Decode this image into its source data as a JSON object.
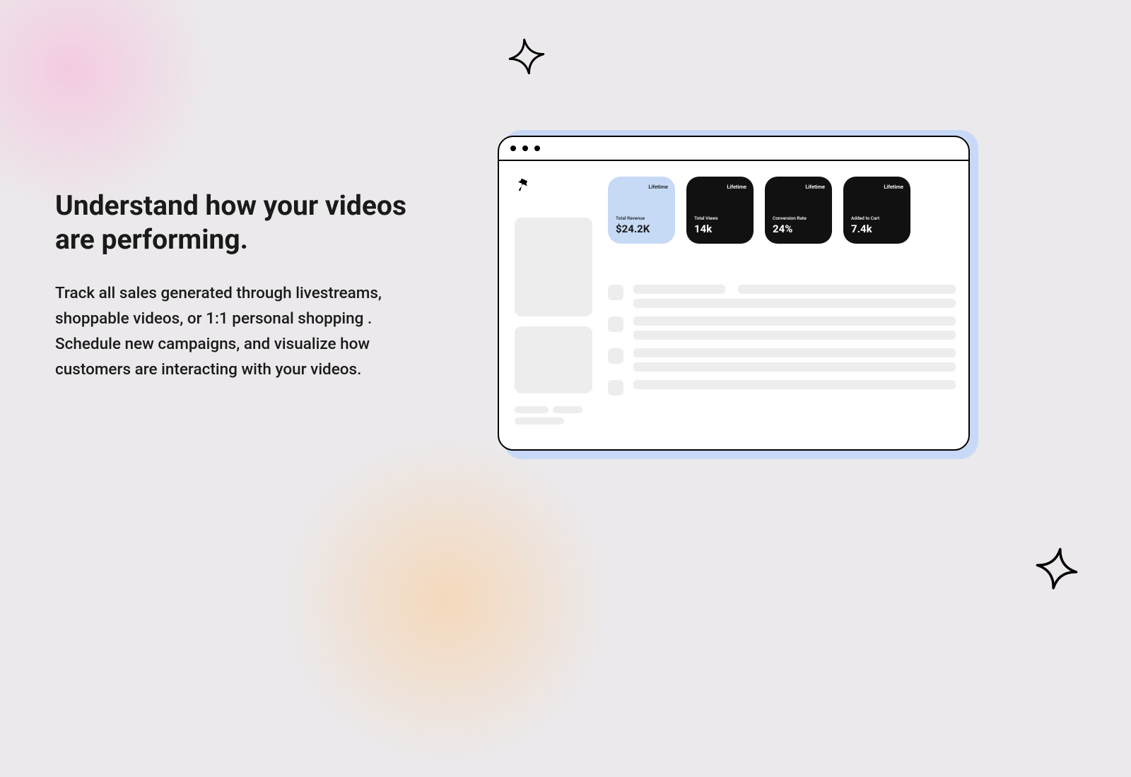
{
  "heading": "Understand how your videos are performing.",
  "body": "Track all sales generated through livestreams, shoppable videos, or 1:1 personal shopping . Schedule new campaigns, and visualize how customers are interacting with your videos.",
  "stats": [
    {
      "period": "Lifetime",
      "label": "Total Revenue",
      "value": "$24.2K",
      "variant": "light"
    },
    {
      "period": "Lifetime",
      "label": "Total Views",
      "value": "14k",
      "variant": "dark"
    },
    {
      "period": "Lifetime",
      "label": "Conversion Rate",
      "value": "24%",
      "variant": "dark"
    },
    {
      "period": "Lifetime",
      "label": "Added to Cart",
      "value": "7.4k",
      "variant": "dark"
    }
  ]
}
